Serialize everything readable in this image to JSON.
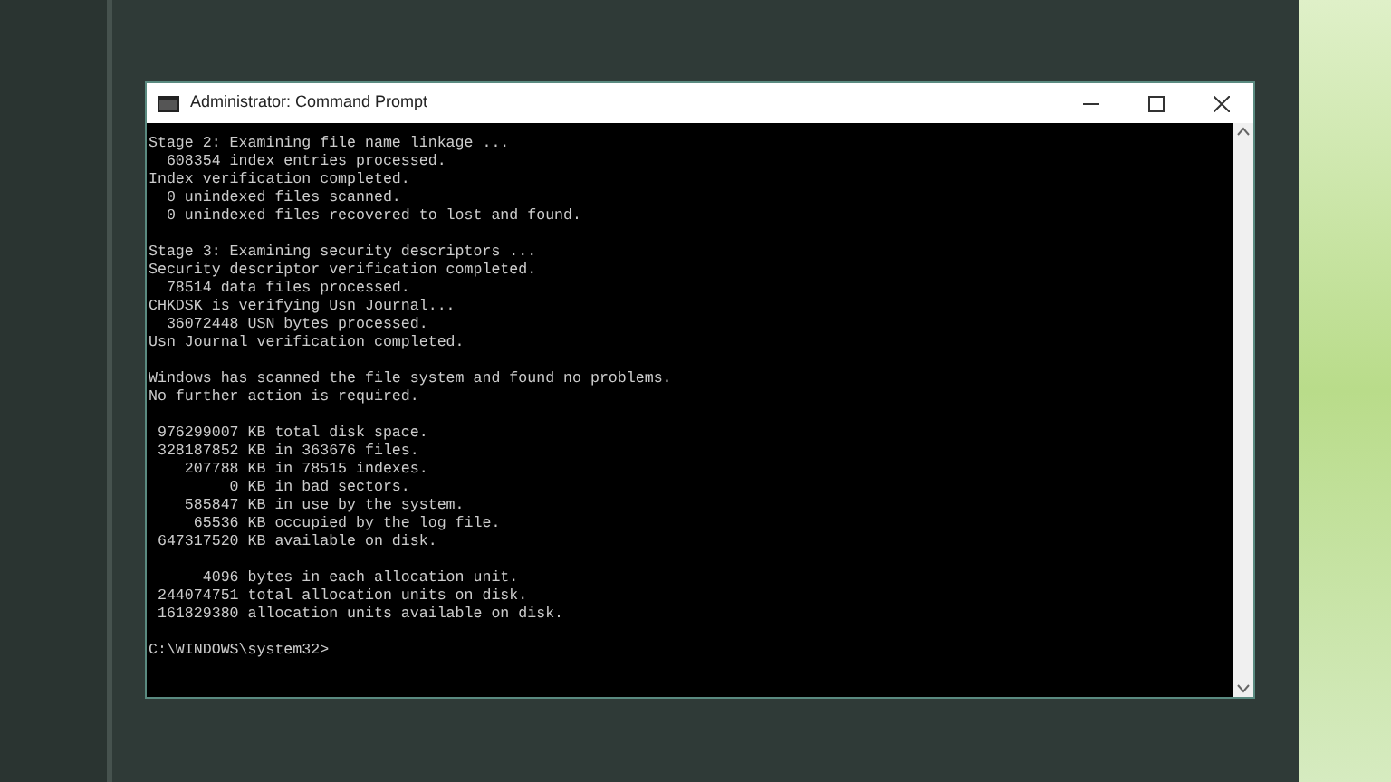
{
  "window": {
    "title": "Administrator: Command Prompt"
  },
  "console": {
    "blocks": [
      [
        "Stage 2: Examining file name linkage ...",
        "  608354 index entries processed.",
        "Index verification completed.",
        "  0 unindexed files scanned.",
        "  0 unindexed files recovered to lost and found."
      ],
      [
        "Stage 3: Examining security descriptors ...",
        "Security descriptor verification completed.",
        "  78514 data files processed.",
        "CHKDSK is verifying Usn Journal...",
        "  36072448 USN bytes processed.",
        "Usn Journal verification completed."
      ],
      [
        "Windows has scanned the file system and found no problems.",
        "No further action is required."
      ],
      [
        " 976299007 KB total disk space.",
        " 328187852 KB in 363676 files.",
        "    207788 KB in 78515 indexes.",
        "         0 KB in bad sectors.",
        "    585847 KB in use by the system.",
        "     65536 KB occupied by the log file.",
        " 647317520 KB available on disk."
      ],
      [
        "      4096 bytes in each allocation unit.",
        " 244074751 total allocation units on disk.",
        " 161829380 allocation units available on disk."
      ],
      [
        "C:\\WINDOWS\\system32>"
      ]
    ]
  }
}
